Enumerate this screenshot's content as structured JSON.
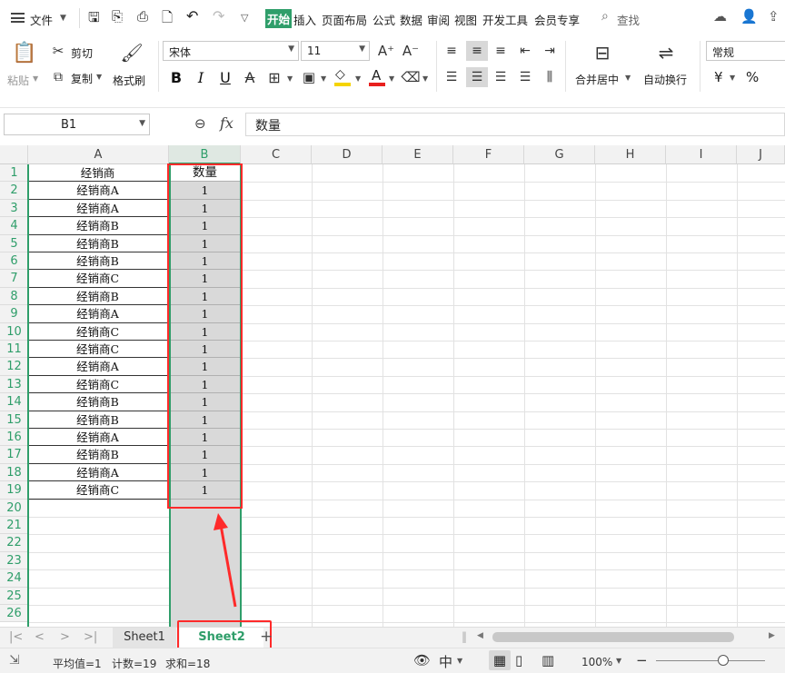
{
  "menu": {
    "file": "文件",
    "tabs": [
      "开始",
      "插入",
      "页面布局",
      "公式",
      "数据",
      "审阅",
      "视图",
      "开发工具",
      "会员专享"
    ],
    "search": "查找"
  },
  "ribbon": {
    "paste": "粘贴",
    "cut": "剪切",
    "copy": "复制",
    "format_painter": "格式刷",
    "font_name": "宋体",
    "font_size": "11",
    "bold": "B",
    "italic": "I",
    "underline": "U",
    "merge_center": "合并居中",
    "wrap_text": "自动换行",
    "number_format": "常规",
    "currency": "¥",
    "percent": "%"
  },
  "formula_bar": {
    "cell_ref": "B1",
    "fx": "fx",
    "content": "数量"
  },
  "columns": [
    "A",
    "B",
    "C",
    "D",
    "E",
    "F",
    "G",
    "H",
    "I",
    "J"
  ],
  "rows": [
    "1",
    "2",
    "3",
    "4",
    "5",
    "6",
    "7",
    "8",
    "9",
    "10",
    "11",
    "12",
    "13",
    "14",
    "15",
    "16",
    "17",
    "18",
    "19",
    "20",
    "21",
    "22",
    "23",
    "24",
    "25",
    "26"
  ],
  "table": {
    "header": [
      "经销商",
      "数量"
    ],
    "rows": [
      [
        "经销商A",
        "1"
      ],
      [
        "经销商A",
        "1"
      ],
      [
        "经销商B",
        "1"
      ],
      [
        "经销商B",
        "1"
      ],
      [
        "经销商B",
        "1"
      ],
      [
        "经销商C",
        "1"
      ],
      [
        "经销商B",
        "1"
      ],
      [
        "经销商A",
        "1"
      ],
      [
        "经销商C",
        "1"
      ],
      [
        "经销商C",
        "1"
      ],
      [
        "经销商A",
        "1"
      ],
      [
        "经销商C",
        "1"
      ],
      [
        "经销商B",
        "1"
      ],
      [
        "经销商B",
        "1"
      ],
      [
        "经销商A",
        "1"
      ],
      [
        "经销商B",
        "1"
      ],
      [
        "经销商A",
        "1"
      ],
      [
        "经销商C",
        "1"
      ]
    ]
  },
  "sheets": {
    "tab1": "Sheet1",
    "tab2": "Sheet2"
  },
  "status": {
    "average": "平均值=1",
    "count": "计数=19",
    "sum": "求和=18",
    "zoom": "100%"
  },
  "colors": {
    "accent": "#2f9e6a",
    "highlight": "#ff2a2a",
    "selection": "#d9d9d9"
  }
}
